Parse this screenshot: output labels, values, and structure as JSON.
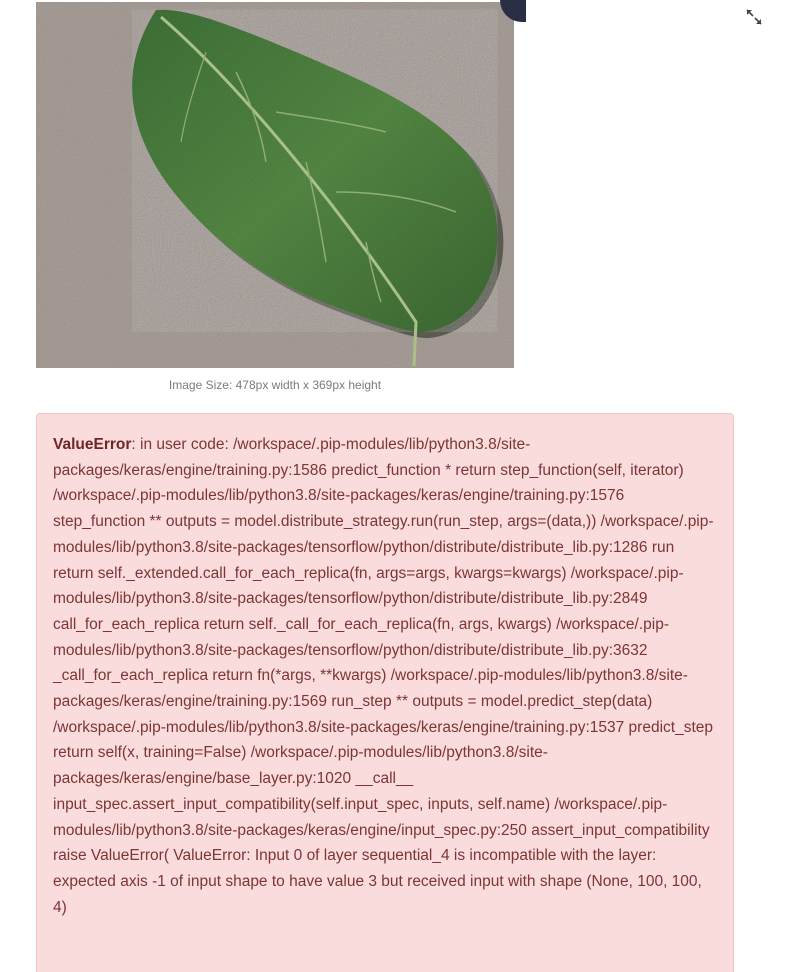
{
  "image": {
    "caption": "Image Size: 478px width x 369px height",
    "subject": "green leaf on gravel background"
  },
  "toolbar": {
    "expand_icon": "expand-icon"
  },
  "error": {
    "title": "ValueError",
    "message": ": in user code: /workspace/.pip-modules/lib/python3.8/site-packages/keras/engine/training.py:1586 predict_function * return step_function(self, iterator) /workspace/.pip-modules/lib/python3.8/site-packages/keras/engine/training.py:1576 step_function ** outputs = model.distribute_strategy.run(run_step, args=(data,)) /workspace/.pip-modules/lib/python3.8/site-packages/tensorflow/python/distribute/distribute_lib.py:1286 run return self._extended.call_for_each_replica(fn, args=args, kwargs=kwargs) /workspace/.pip-modules/lib/python3.8/site-packages/tensorflow/python/distribute/distribute_lib.py:2849 call_for_each_replica return self._call_for_each_replica(fn, args, kwargs) /workspace/.pip-modules/lib/python3.8/site-packages/tensorflow/python/distribute/distribute_lib.py:3632 _call_for_each_replica return fn(*args, **kwargs) /workspace/.pip-modules/lib/python3.8/site-packages/keras/engine/training.py:1569 run_step ** outputs = model.predict_step(data) /workspace/.pip-modules/lib/python3.8/site-packages/keras/engine/training.py:1537 predict_step return self(x, training=False) /workspace/.pip-modules/lib/python3.8/site-packages/keras/engine/base_layer.py:1020 __call__ input_spec.assert_input_compatibility(self.input_spec, inputs, self.name) /workspace/.pip-modules/lib/python3.8/site-packages/keras/engine/input_spec.py:250 assert_input_compatibility raise ValueError( ValueError: Input 0 of layer sequential_4 is incompatible with the layer: expected axis -1 of input shape to have value 3 but received input with shape (None, 100, 100, 4)"
  },
  "colors": {
    "error_background": "#f9dcdb",
    "error_text": "#7d3535",
    "leaf": "#4a7a3e"
  }
}
